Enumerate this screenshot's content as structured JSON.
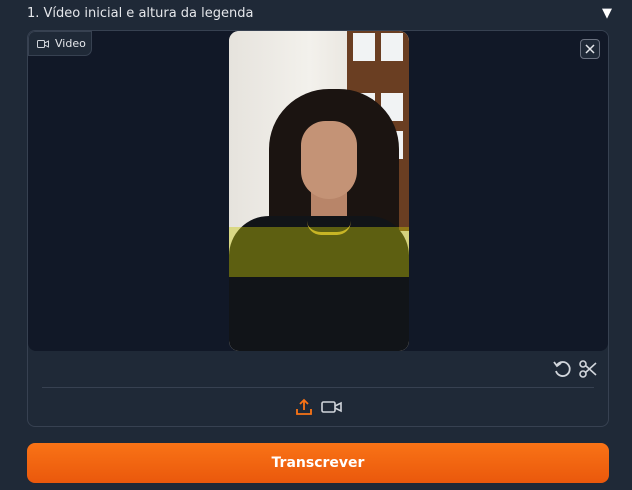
{
  "accordion": {
    "title": "1. Vídeo inicial e altura da legenda",
    "caret_icon": "triangle-down-icon"
  },
  "video_input": {
    "label": "Video",
    "label_icon": "video-camera-icon",
    "close_icon": "close-icon",
    "overlay_band_color": "#c8c80a",
    "tools": [
      "undo-icon",
      "scissors-icon"
    ],
    "sources": [
      "upload-icon",
      "webcam-icon"
    ]
  },
  "actions": {
    "submit_label": "Transcrever",
    "accent_color": "#f97316"
  }
}
